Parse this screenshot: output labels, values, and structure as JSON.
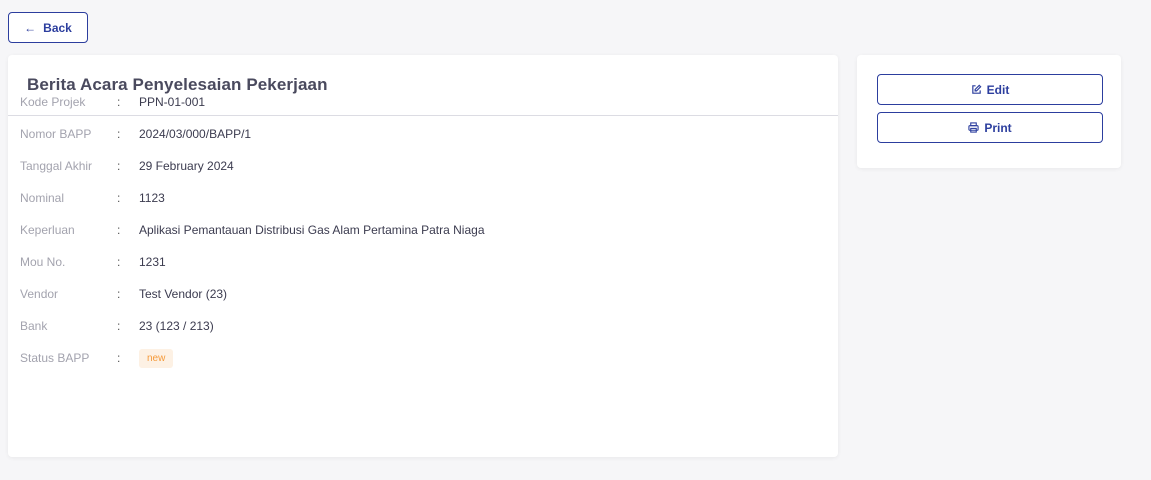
{
  "nav": {
    "back_label": "Back"
  },
  "card": {
    "title": "Berita Acara Penyelesaian Pekerjaan",
    "fields": [
      {
        "label": "Kode Projek",
        "value": "PPN-01-001"
      },
      {
        "label": "Nomor BAPP",
        "value": "2024/03/000/BAPP/1"
      },
      {
        "label": "Tanggal Akhir",
        "value": "29 February 2024"
      },
      {
        "label": "Nominal",
        "value": "1123"
      },
      {
        "label": "Keperluan",
        "value": "Aplikasi Pemantauan Distribusi Gas Alam Pertamina Patra Niaga"
      },
      {
        "label": "Mou No.",
        "value": "1231"
      },
      {
        "label": "Vendor",
        "value": "Test Vendor (23)"
      },
      {
        "label": "Bank",
        "value": "23 (123 / 213)"
      },
      {
        "label": "Status BAPP",
        "value": "new"
      }
    ],
    "colon": ":"
  },
  "actions": {
    "edit_label": "Edit",
    "print_label": "Print"
  },
  "colors": {
    "accent": "#2c3e9e",
    "badge_bg": "#fdf1e4",
    "badge_text": "#f59a3a"
  }
}
